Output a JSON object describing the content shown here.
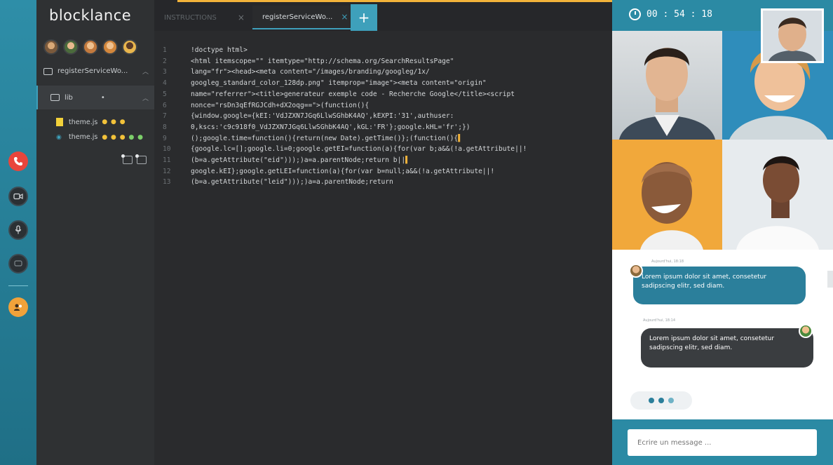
{
  "app": {
    "logo": "blocklance"
  },
  "rail": {
    "items": [
      {
        "name": "phone-icon",
        "glyph": "✆",
        "color": "#e8453c"
      },
      {
        "name": "video-icon",
        "glyph": "▭",
        "color": "#2b3034"
      },
      {
        "name": "microphone-icon",
        "glyph": "🎙",
        "color": "#2b3034"
      },
      {
        "name": "chat-icon",
        "glyph": "▢",
        "color": "#2b3034"
      },
      {
        "name": "add-user-icon",
        "glyph": "✚",
        "color": "#f1a23a"
      }
    ]
  },
  "sidebar": {
    "project": "registerServiceWo...",
    "folder": "lib",
    "files": [
      {
        "name": "theme.js",
        "status": "modified"
      },
      {
        "name": "theme.js",
        "status": "modified"
      }
    ]
  },
  "tabs": [
    {
      "label": "INSTRUCTIONS",
      "active": false
    },
    {
      "label": "registerServiceWo...",
      "active": true
    }
  ],
  "tab_add_label": "+",
  "code": {
    "lines": [
      "!doctype html>",
      "<html itemscope=\"\" itemtype=\"http://schema.org/SearchResultsPage\"",
      "lang=\"fr\"><head><meta content=\"/images/branding/googleg/1x/",
      "googleg_standard_color_128dp.png\" itemprop=\"image\"><meta content=\"origin\"",
      "name=\"referrer\"><title>generateur exemple code - Recherche Google</title><script",
      "nonce=\"rsDn3qEfRGJCdh+dX2oqg==\">(function(){",
      "{window.google={kEI:'VdJZXN7JGq6LlwSGhbK4AQ',kEXPI:'31',authuser:",
      "0,kscs:'c9c918f0_VdJZXN7JGq6LlwSGhbK4AQ',kGL:'FR'};google.kHL='fr';})",
      "();google.time=function(){return(new Date).getTime()};(function(){",
      "{google.lc=[];google.li=0;google.getEI=function(a){for(var b;a&&(!a.getAttribute||!",
      "(b=a.getAttribute(\"eid\")));)a=a.parentNode;return b||",
      "google.kEI};google.getLEI=function(a){for(var b=null;a&&(!a.getAttribute||!",
      "(b=a.getAttribute(\"leid\")));)a=a.parentNode;return"
    ],
    "line_numbers": [
      "1",
      "2",
      "3",
      "4",
      "5",
      "6",
      "7",
      "8",
      "9",
      "10",
      "11",
      "12",
      "13"
    ]
  },
  "call": {
    "timer": "00 : 54 : 18"
  },
  "chat": {
    "messages": [
      {
        "meta": "Aujourd'hui, 18:18",
        "text": "Lorem ipsum dolor sit amet, consetetur sadipscing elitr, sed diam."
      },
      {
        "meta": "Aujourd'hui, 18:14",
        "text": "Lorem ipsum dolor sit amet, consetetur sadipscing elitr, sed diam."
      }
    ],
    "input_placeholder": "Écrire un message ..."
  },
  "colors": {
    "accent": "#2b8aa4",
    "highlight": "#f2b33a",
    "danger": "#e8453c"
  }
}
